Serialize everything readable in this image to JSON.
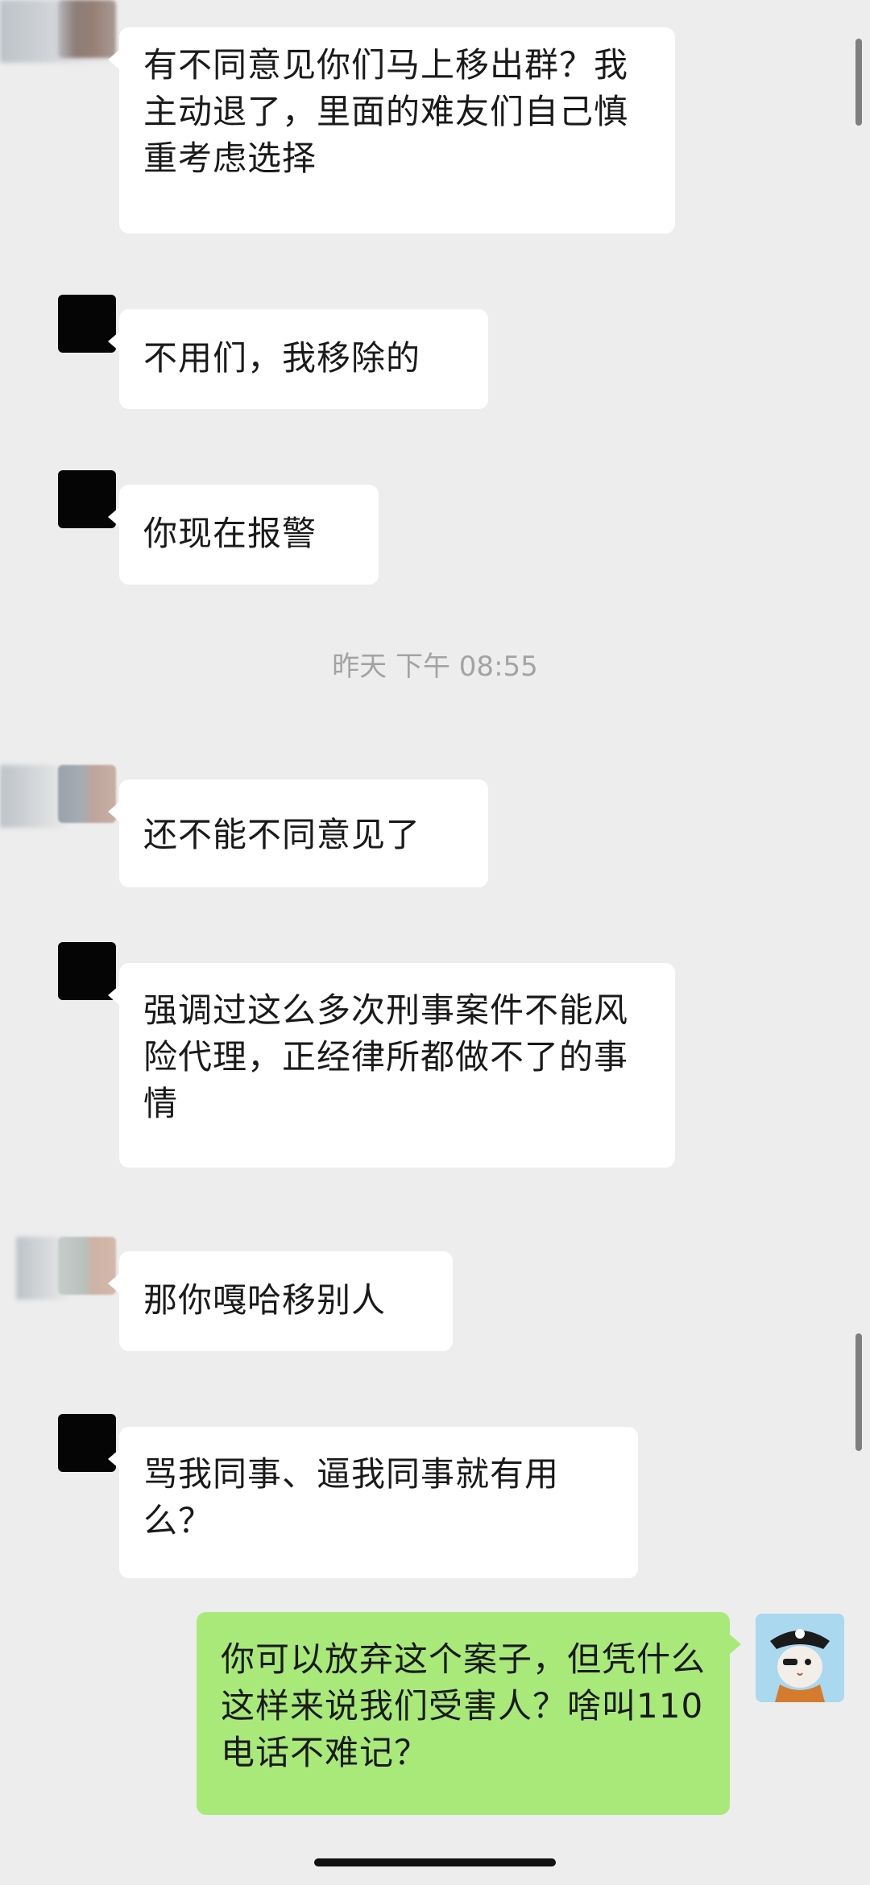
{
  "messages": [
    {
      "side": "left",
      "text": "有不同意见你们马上移出群？我主动退了，里面的难友们自己慎重考虑选择",
      "avatar_icon": "blurred-avatar-icon"
    },
    {
      "side": "left",
      "text": "不用们，我移除的",
      "avatar_icon": "redacted-avatar-icon"
    },
    {
      "side": "left",
      "text": "你现在报警",
      "avatar_icon": "redacted-avatar-icon"
    },
    {
      "side": "left",
      "text": "还不能不同意见了",
      "avatar_icon": "blurred-avatar-icon"
    },
    {
      "side": "left",
      "text": "强调过这么多次刑事案件不能风险代理，正经律所都做不了的事情",
      "avatar_icon": "redacted-avatar-icon"
    },
    {
      "side": "left",
      "text": "那你嘎哈移别人",
      "avatar_icon": "blurred-avatar-icon"
    },
    {
      "side": "left",
      "text": "骂我同事、逼我同事就有用么？",
      "avatar_icon": "redacted-avatar-icon"
    },
    {
      "side": "right",
      "text": "你可以放弃这个案子，但凭什么这样来说我们受害人？啥叫110电话不难记？",
      "avatar_icon": "pirate-cat-avatar-icon"
    }
  ],
  "timestamp": "昨天 下午 08:55",
  "colors": {
    "background": "#ededed",
    "incoming_bubble": "#ffffff",
    "outgoing_bubble": "#a9e97a",
    "timestamp_text": "#a3a3a3"
  }
}
